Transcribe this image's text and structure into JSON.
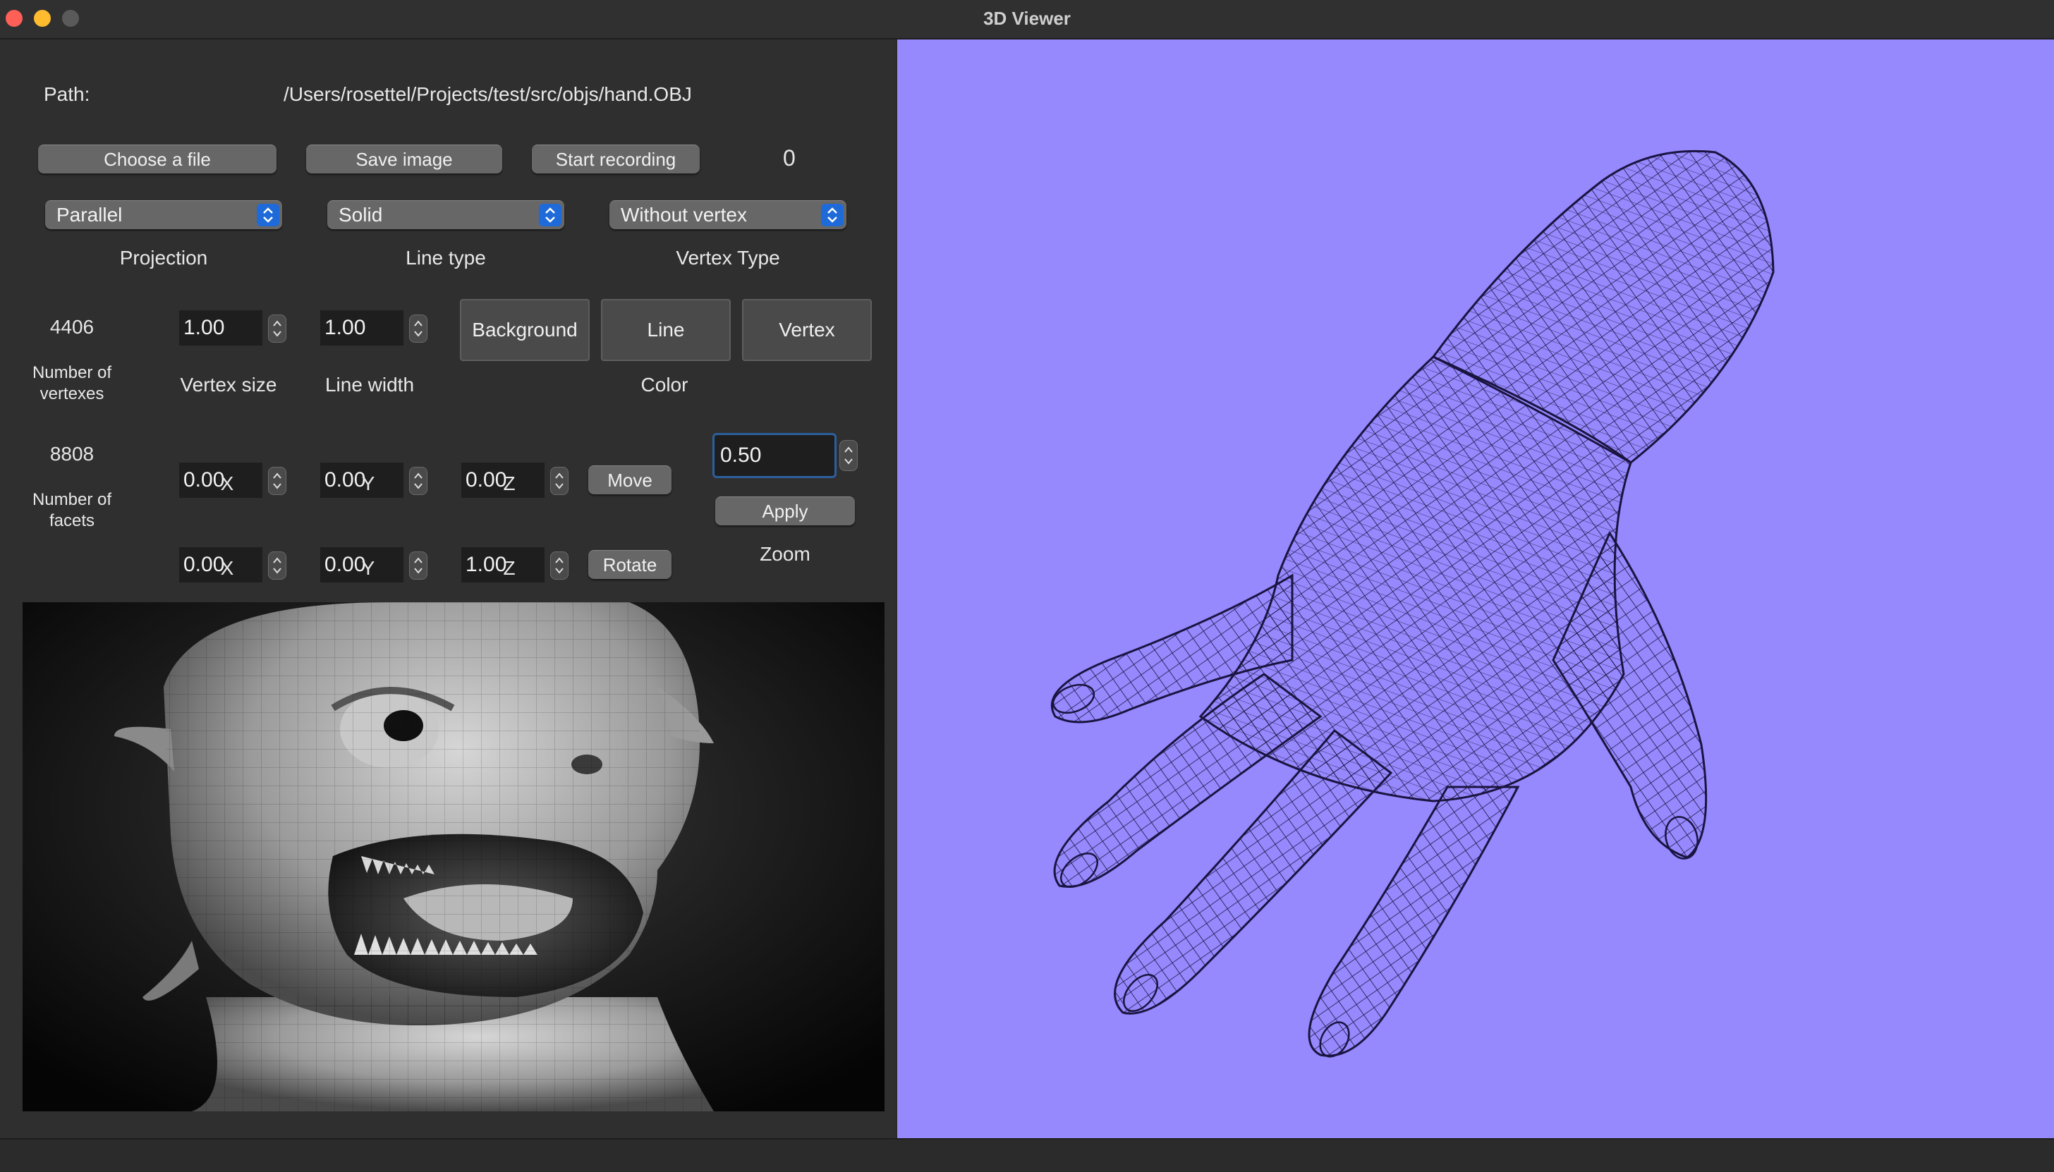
{
  "window": {
    "title": "3D Viewer"
  },
  "file": {
    "path_label": "Path:",
    "path_value": "/Users/rosettel/Projects/test/src/objs/hand.OBJ"
  },
  "toolbar": {
    "choose_file": "Choose a file",
    "save_image": "Save image",
    "start_recording": "Start recording",
    "recording_count": "0"
  },
  "selects": {
    "projection": {
      "value": "Parallel",
      "label": "Projection"
    },
    "line_type": {
      "value": "Solid",
      "label": "Line type"
    },
    "vertex_type": {
      "value": "Without vertex",
      "label": "Vertex Type"
    }
  },
  "stats": {
    "vertex_count": "4406",
    "vertex_count_label": "Number of vertexes",
    "facet_count": "8808",
    "facet_count_label": "Number of facets"
  },
  "sizes": {
    "vertex_size": "1.00",
    "vertex_size_label": "Vertex size",
    "line_width": "1.00",
    "line_width_label": "Line width"
  },
  "color": {
    "label": "Color",
    "background_button": "Background",
    "line_button": "Line",
    "vertex_button": "Vertex"
  },
  "move": {
    "x": "0.00",
    "y": "0.00",
    "z": "0.00",
    "x_label": "X",
    "y_label": "Y",
    "z_label": "Z",
    "button": "Move"
  },
  "rotate": {
    "x": "0.00",
    "y": "0.00",
    "z": "1.00",
    "x_label": "X",
    "y_label": "Y",
    "z_label": "Z",
    "button": "Rotate"
  },
  "zoom": {
    "value": "0.50",
    "apply_button": "Apply",
    "label": "Zoom"
  },
  "colors": {
    "viewer_background": "#9688fd",
    "wireframe_line": "#1a1440",
    "select_accent": "#1f6ad9",
    "panel_background": "#2f2f2f"
  },
  "icons": {
    "close": "close-icon",
    "minimize": "minimize-icon",
    "zoom": "zoom-icon",
    "select_arrows": "chevron-updown-icon",
    "spin_arrows": "stepper-arrows-icon"
  }
}
